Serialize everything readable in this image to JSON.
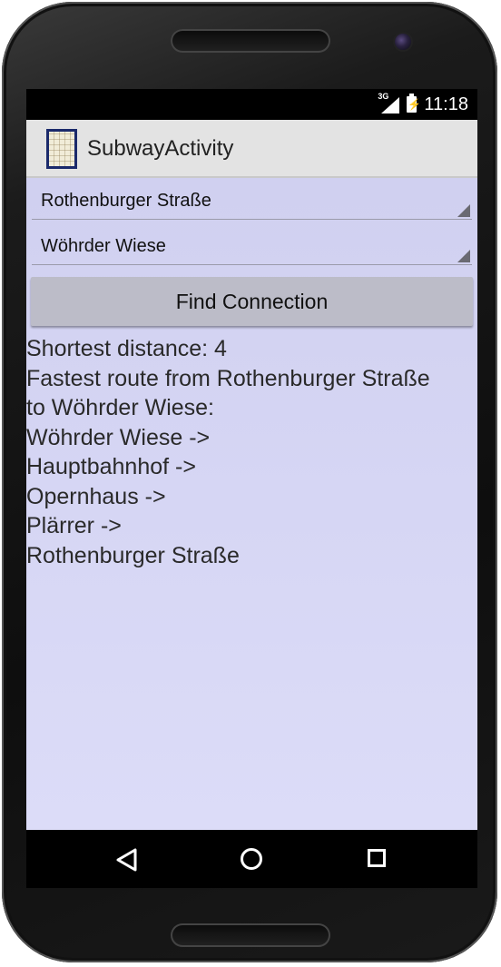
{
  "status_bar": {
    "network": "3G",
    "time": "11:18"
  },
  "action_bar": {
    "title": "SubwayActivity",
    "icon": "subway-map-icon"
  },
  "form": {
    "from_station": "Rothenburger Straße",
    "to_station": "Wöhrder Wiese",
    "find_button_label": "Find Connection"
  },
  "result": {
    "lines": [
      "Shortest distance: 4",
      "Fastest route from Rothenburger Straße",
      "to Wöhrder Wiese:",
      "Wöhrder Wiese ->",
      "Hauptbahnhof ->",
      "Opernhaus ->",
      "Plärrer ->",
      "Rothenburger Straße"
    ]
  },
  "nav_bar": {
    "back_icon": "back-triangle-icon",
    "home_icon": "home-circle-icon",
    "recent_icon": "recent-apps-square-icon"
  },
  "colors": {
    "content_background": "#d6d6f4",
    "action_bar": "#e3e3e3",
    "button": "#bcbcc8"
  }
}
